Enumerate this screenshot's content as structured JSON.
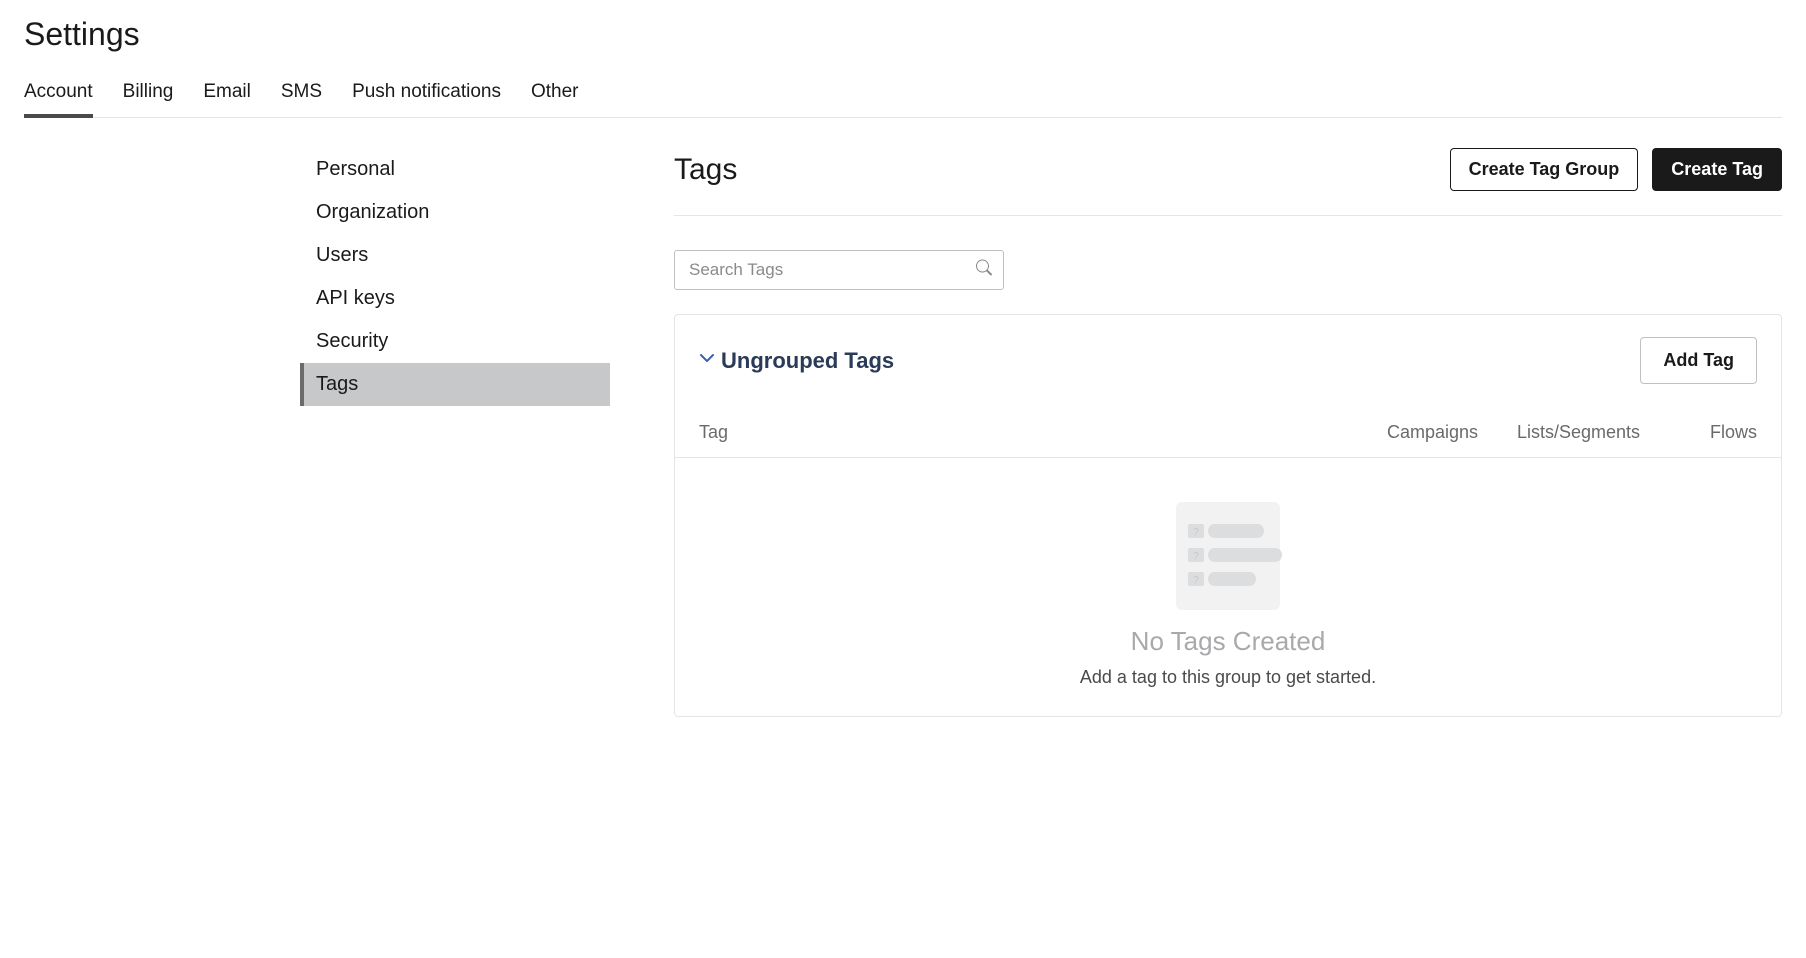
{
  "header": {
    "title": "Settings"
  },
  "tabs": [
    {
      "label": "Account",
      "active": true
    },
    {
      "label": "Billing",
      "active": false
    },
    {
      "label": "Email",
      "active": false
    },
    {
      "label": "SMS",
      "active": false
    },
    {
      "label": "Push notifications",
      "active": false
    },
    {
      "label": "Other",
      "active": false
    }
  ],
  "sidebar": {
    "items": [
      {
        "label": "Personal",
        "active": false
      },
      {
        "label": "Organization",
        "active": false
      },
      {
        "label": "Users",
        "active": false
      },
      {
        "label": "API keys",
        "active": false
      },
      {
        "label": "Security",
        "active": false
      },
      {
        "label": "Tags",
        "active": true
      }
    ]
  },
  "main": {
    "title": "Tags",
    "create_group_label": "Create Tag Group",
    "create_tag_label": "Create Tag",
    "search": {
      "placeholder": "Search Tags"
    },
    "panel": {
      "title": "Ungrouped Tags",
      "add_label": "Add Tag",
      "columns": {
        "tag": "Tag",
        "campaigns": "Campaigns",
        "lists": "Lists/Segments",
        "flows": "Flows"
      },
      "empty": {
        "title": "No Tags Created",
        "subtitle": "Add a tag to this group to get started."
      }
    }
  }
}
